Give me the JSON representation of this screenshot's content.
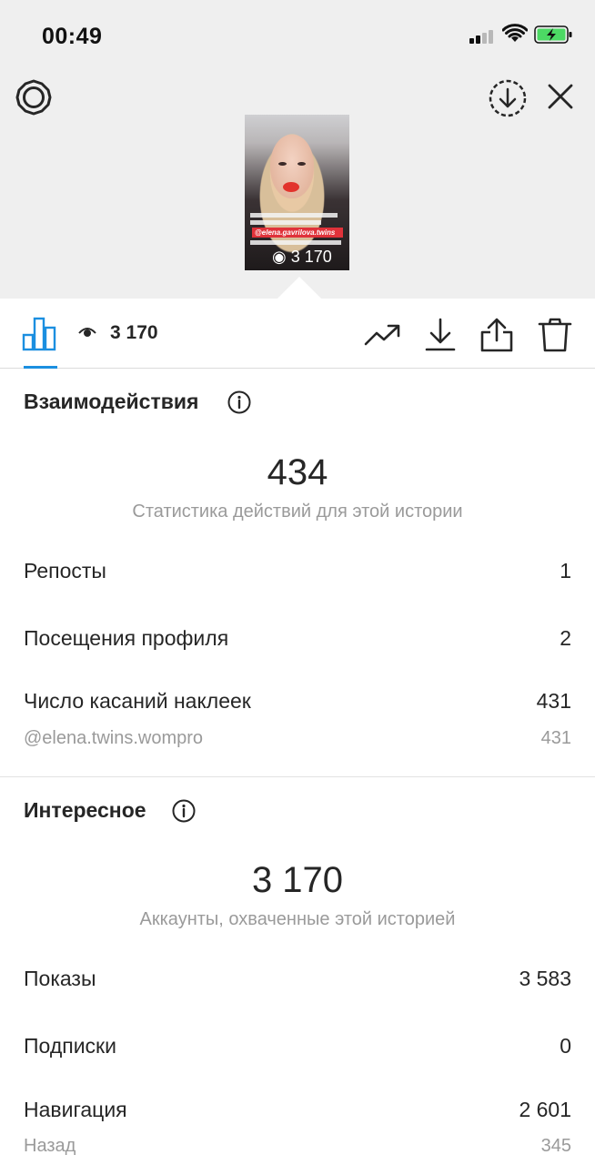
{
  "status_bar": {
    "time": "00:49"
  },
  "story_preview": {
    "mention": "@elena.gavrilova.twins",
    "views_overlay": "3 170"
  },
  "toolbar": {
    "views": "3 170"
  },
  "interactions": {
    "title": "Взаимодействия",
    "total": "434",
    "caption": "Статистика действий для этой истории",
    "rows": [
      {
        "label": "Репосты",
        "value": "1"
      },
      {
        "label": "Посещения профиля",
        "value": "2"
      },
      {
        "label": "Число касаний наклеек",
        "value": "431"
      }
    ],
    "sticker_sub": {
      "label": "@elena.twins.wompro",
      "value": "431"
    }
  },
  "discovery": {
    "title": "Интересное",
    "total": "3 170",
    "caption": "Аккаунты, охваченные этой историей",
    "rows": [
      {
        "label": "Показы",
        "value": "3 583"
      },
      {
        "label": "Подписки",
        "value": "0"
      },
      {
        "label": "Навигация",
        "value": "2 601"
      }
    ],
    "navigation_sub": {
      "label": "Назад",
      "value": "345"
    }
  },
  "colors": {
    "accent": "#1b8fe0",
    "top_background": "#efefef",
    "muted_text": "#9a9a9a",
    "battery_green": "#4cd964"
  },
  "icons": [
    "settings-gear-icon",
    "download-circle-icon",
    "close-icon",
    "bar-chart-icon",
    "eye-icon",
    "trending-icon",
    "download-icon",
    "share-icon",
    "trash-icon",
    "info-icon"
  ]
}
